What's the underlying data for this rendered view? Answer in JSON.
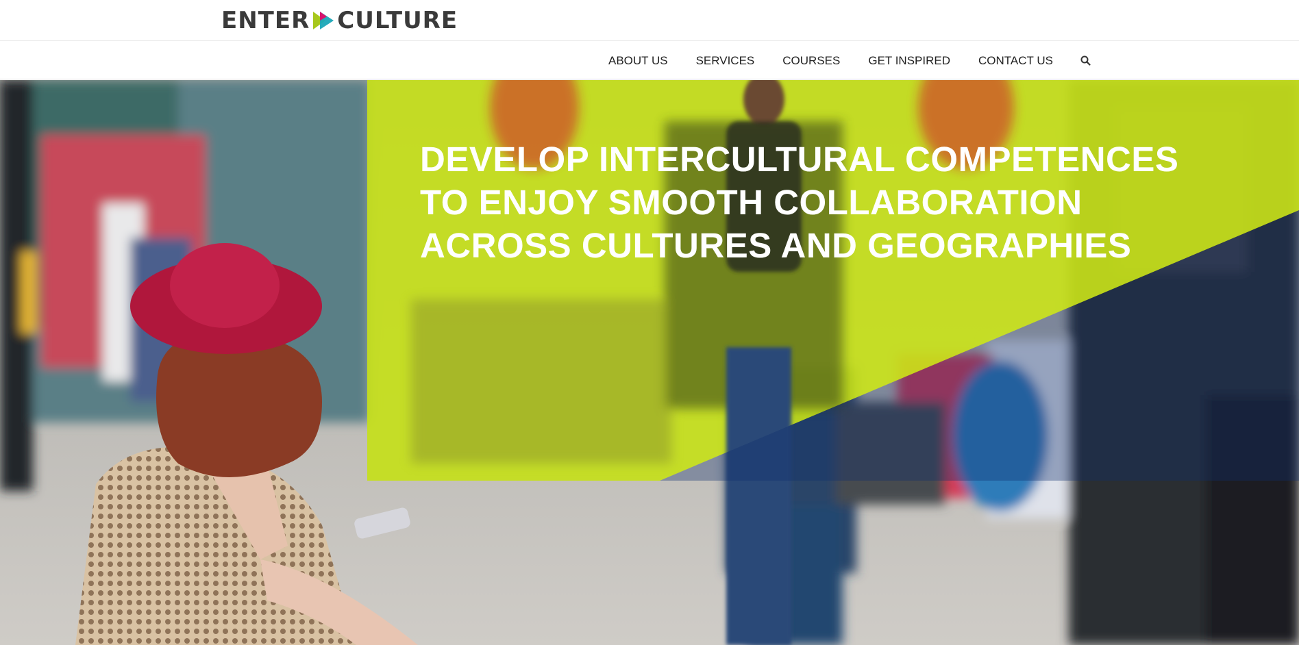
{
  "brand": {
    "name_left": "ENTER",
    "name_right": "CULTURE",
    "colors": {
      "text": "#3a3a3a",
      "mark_green": "#a8c81c",
      "mark_teal": "#1aa6b7",
      "mark_magenta": "#d8136b"
    }
  },
  "nav": {
    "items": [
      {
        "label": "ABOUT US"
      },
      {
        "label": "SERVICES"
      },
      {
        "label": "COURSES"
      },
      {
        "label": "GET INSPIRED"
      },
      {
        "label": "CONTACT US"
      }
    ],
    "search_icon": "search-icon"
  },
  "hero": {
    "headline_lines": [
      "DEVELOP INTERCULTURAL COMPETENCES",
      "TO ENJOY SMOOTH COLLABORATION",
      "ACROSS CULTURES AND GEOGRAPHIES"
    ],
    "overlay_color": "#c5e01a",
    "accent_color": "#0e2f6e"
  }
}
